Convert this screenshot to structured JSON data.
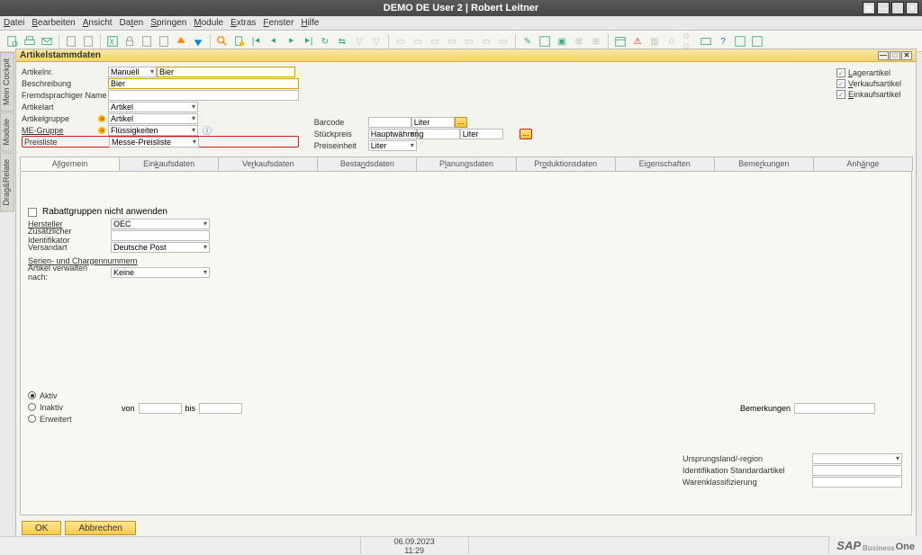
{
  "titlebar": {
    "title": "DEMO DE User 2 | Robert Leitner"
  },
  "menu": {
    "datei": "Datei",
    "bearbeiten": "Bearbeiten",
    "ansicht": "Ansicht",
    "daten": "Daten",
    "springen": "Springen",
    "module": "Module",
    "extras": "Extras",
    "fenster": "Fenster",
    "hilfe": "Hilfe"
  },
  "window": {
    "title": "Artikelstammdaten"
  },
  "sidetabs": {
    "a": "Mein Cockpit",
    "b": "Module",
    "c": "Drag&Relate"
  },
  "form": {
    "artikelnr_label": "Artikelnr.",
    "artikelnr_mode": "Manuell",
    "artikelnr_value": "Bier",
    "beschreibung_label": "Beschreibung",
    "beschreibung_value": "Bier",
    "fremdspr_label": "Fremdsprachiger Name",
    "fremdspr_value": "",
    "artikelart_label": "Artikelart",
    "artikelart_value": "Artikel",
    "artikelgruppe_label": "Artikelgruppe",
    "artikelgruppe_value": "Artikel",
    "megruppe_label": "ME-Gruppe",
    "megruppe_value": "Flüssigkeiten",
    "preisliste_label": "Preisliste",
    "preisliste_value": "Messe-Preisliste",
    "barcode_label": "Barcode",
    "barcode_value": "",
    "barcode_unit": "Liter",
    "stueckpreis_label": "Stückpreis",
    "stueckpreis_curr": "Hauptwährung",
    "stueckpreis_value": "",
    "stueckpreis_unit": "Liter",
    "preiseinheit_label": "Preiseinheit",
    "preiseinheit_value": "Liter",
    "cb_lager": "Lagerartikel",
    "cb_verkauf": "Verkaufsartikel",
    "cb_einkauf": "Einkaufsartikel"
  },
  "tabs": {
    "allgemein": "Allgemein",
    "einkauf": "Einkaufsdaten",
    "verkauf": "Verkaufsdaten",
    "bestand": "Bestandsdaten",
    "planung": "Planungsdaten",
    "produktion": "Produktionsdaten",
    "eigenschaften": "Eigenschaften",
    "bemerkungen": "Bemerkungen",
    "anhaenge": "Anhänge"
  },
  "content": {
    "rabatt_label": "Rabattgruppen nicht anwenden",
    "hersteller_label": "Hersteller",
    "hersteller_value": "OEC",
    "zusid_label": "Zusätzlicher Identifikator",
    "zusid_value": "",
    "versandart_label": "Versandart",
    "versandart_value": "Deutsche Post",
    "serien_label": "Serien- und Chargennummern",
    "verwalten_label": "Artikel verwalten nach:",
    "verwalten_value": "Keine",
    "aktiv_label": "Aktiv",
    "inaktiv_label": "Inaktiv",
    "erweitert_label": "Erweitert",
    "von_label": "von",
    "bis_label": "bis",
    "von_value": "",
    "bis_value": "",
    "bemerkungen_label": "Bemerkungen",
    "bemerkungen_value": "",
    "ursprung_label": "Ursprungsland/-region",
    "ursprung_value": "",
    "idstd_label": "Identifikation Standardartikel",
    "idstd_value": "",
    "warenklass_label": "Warenklassifizierung",
    "warenklass_value": ""
  },
  "buttons": {
    "ok": "OK",
    "abbrechen": "Abbrechen"
  },
  "status": {
    "date": "06.09.2023",
    "time": "11:29",
    "brand1": "SAP",
    "brand2": "Business",
    "brand3": "One"
  }
}
